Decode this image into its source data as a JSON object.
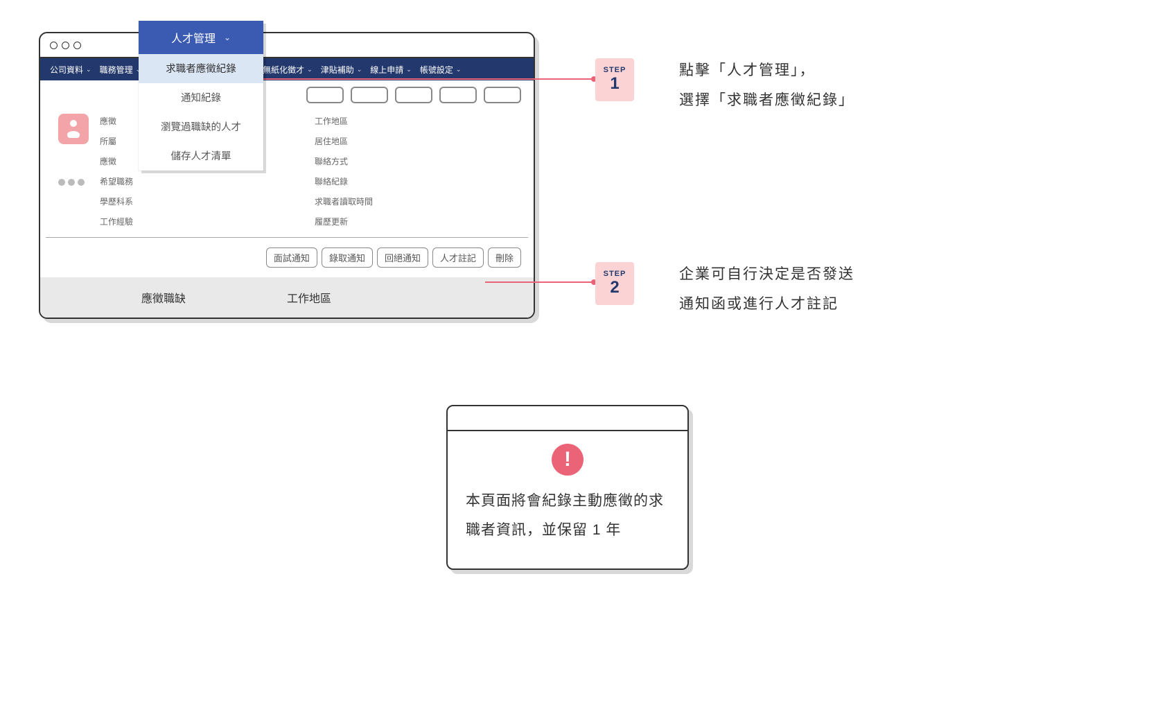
{
  "nav": {
    "items": [
      "公司資料",
      "職務管理",
      "人才管理",
      "無紙化徵才",
      "津貼補助",
      "線上申請",
      "帳號設定"
    ]
  },
  "dropdown": {
    "header": "人才管理",
    "items": [
      "求職者應徵紀錄",
      "通知紀錄",
      "瀏覽過職缺的人才",
      "儲存人才清單"
    ]
  },
  "fields": {
    "left": [
      "應徵",
      "所屬",
      "應徵",
      "希望職務",
      "學歷科系",
      "工作經驗"
    ],
    "right": [
      "工作地區",
      "居住地區",
      "聯絡方式",
      "聯絡紀錄",
      "求職者讀取時間",
      "履歷更新"
    ]
  },
  "actions": [
    "面試通知",
    "錄取通知",
    "回絕通知",
    "人才註記",
    "刪除"
  ],
  "summary": {
    "left": "應徵職缺",
    "right": "工作地區"
  },
  "steps": {
    "label": "STEP",
    "s1": {
      "num": "1",
      "text": "點擊「人才管理」，\n選擇「求職者應徵紀錄」"
    },
    "s2": {
      "num": "2",
      "text": "企業可自行決定是否發送\n通知函或進行人才註記"
    }
  },
  "notice": {
    "icon": "!",
    "text": "本頁面將會紀錄主動應徵的求職者資訊，並保留 1 年"
  }
}
